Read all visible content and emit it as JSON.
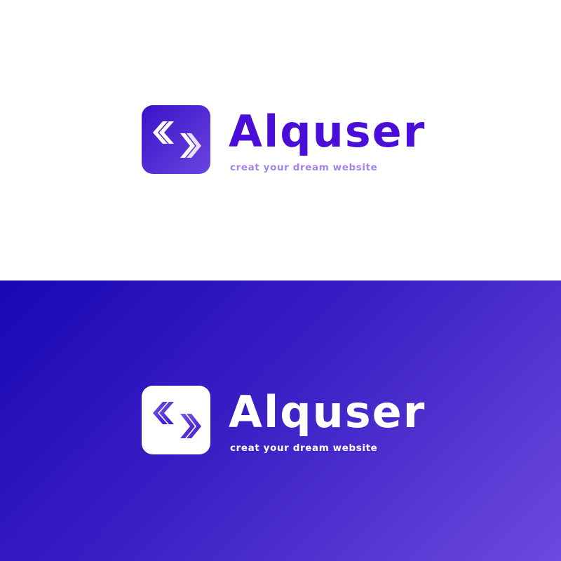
{
  "brand": {
    "name": "Alquser",
    "tagline": "creat your dream website"
  },
  "colors": {
    "primary": "#4a0ed8",
    "tagline_light": "#a583ea",
    "gradient_start": "#1908b4",
    "gradient_end": "#6b4ade"
  },
  "icons": {
    "logo": "double-chevron-code-icon"
  }
}
